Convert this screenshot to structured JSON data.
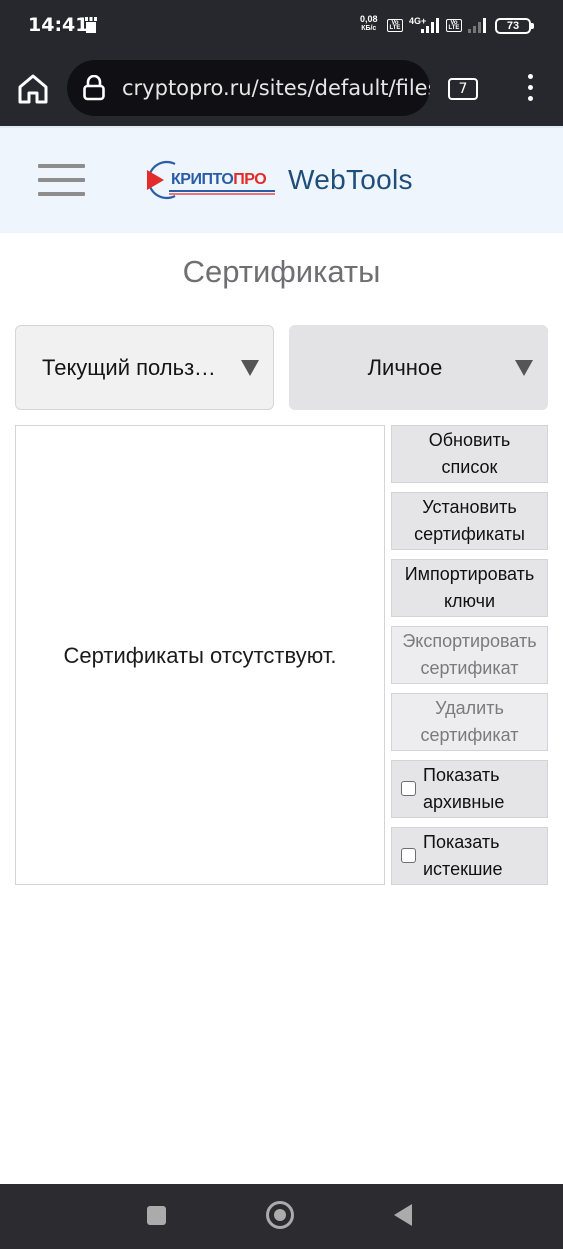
{
  "status_bar": {
    "time": "14:41",
    "speed": "0,08",
    "speed_unit": "КБ/с",
    "volte1": "Vo LTE",
    "network": "4G+",
    "volte2": "Vo LTE",
    "battery": "73",
    "icons": [
      "notification-icon",
      "volte-icon",
      "signal-icon",
      "battery-icon"
    ]
  },
  "browser": {
    "url": "cryptopro.ru/sites/default/files",
    "tab_count": "7",
    "icons": [
      "home-icon",
      "lock-icon",
      "tabs-icon",
      "more-vert-icon"
    ]
  },
  "site": {
    "logo_part1": "КРИПТО",
    "logo_part2": "ПРО",
    "brand": "WebTools",
    "colors": {
      "logo_blue": "#2a5da8",
      "logo_red": "#e32b2b",
      "brand_blue": "#1f4e7a",
      "header_bg": "#eef5fc"
    }
  },
  "page": {
    "title": "Сертификаты",
    "store_select": {
      "value": "Текущий пользователь"
    },
    "location_select": {
      "value": "Личное"
    },
    "empty_message": "Сертификаты отсутствуют.",
    "buttons": {
      "refresh": [
        "Обновить",
        "список"
      ],
      "install": [
        "Установить",
        "сертификаты"
      ],
      "import": [
        "Импортировать",
        "ключи"
      ],
      "export": [
        "Экспортировать",
        "сертификат"
      ],
      "delete": [
        "Удалить",
        "сертификат"
      ]
    },
    "checkboxes": {
      "archived": {
        "label": [
          "Показать",
          "архивные"
        ],
        "checked": false
      },
      "expired": {
        "label": [
          "Показать",
          "истекшие"
        ],
        "checked": false
      }
    }
  }
}
